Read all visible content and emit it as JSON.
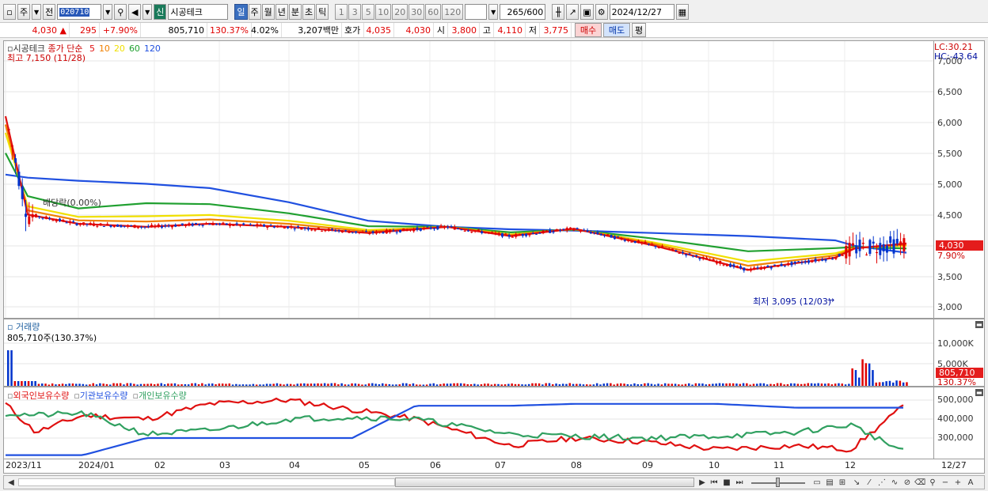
{
  "toolbar": {
    "market": "주",
    "mode": "전",
    "code": "020710",
    "new_tag": "신",
    "name": "시공테크",
    "periods": [
      "일",
      "주",
      "월",
      "년",
      "분",
      "초",
      "틱"
    ],
    "minutes": [
      "1",
      "3",
      "5",
      "10",
      "20",
      "30",
      "60",
      "120"
    ],
    "count": "265",
    "count_max": "/600",
    "date": "2024/12/27"
  },
  "quote": {
    "price": "4,030",
    "arrow": "▲",
    "change": "295",
    "change_pct": "+7.90%",
    "volume": "805,710",
    "vol_ratio": "130.37%",
    "turnover": "4.02%",
    "amount": "3,207백만",
    "hoga_label": "호가",
    "ask": "4,035",
    "bid": "4,030",
    "open_label": "시",
    "open": "3,800",
    "high_label": "고",
    "high": "4,110",
    "low_label": "저",
    "low": "3,775",
    "buy": "매수",
    "sell": "매도",
    "avg": "평"
  },
  "price_panel": {
    "title": "시공테크",
    "ma_label": "종가 단순",
    "ma_periods": [
      "5",
      "10",
      "20",
      "60",
      "120"
    ],
    "ma_colors": [
      "#e01010",
      "#f08000",
      "#f0e000",
      "#20a030",
      "#2050e0"
    ],
    "high_note": "최고 7,150 (11/28)",
    "low_note": "최저 3,095 (12/03)",
    "dividend": "배당락(0.00%)",
    "lc": "LC:30.21",
    "hc": "HC:-43.64",
    "cur_price": "4,030",
    "cur_pct": "7.90%",
    "y_ticks": [
      "7,000",
      "6,500",
      "6,000",
      "5,500",
      "5,000",
      "4,500",
      "4,000",
      "3,500",
      "3,000"
    ]
  },
  "volume_panel": {
    "title": "거래량",
    "info": "805,710주(130.37%)",
    "y_ticks": [
      "10,000K",
      "5,000K"
    ],
    "cur_vol": "805,710",
    "cur_pct": "130.37%"
  },
  "holding_panel": {
    "series": [
      "외국인보유수량",
      "기관보유수량",
      "개인보유수량"
    ],
    "series_colors": [
      "#e01010",
      "#2050e0",
      "#30a060"
    ],
    "y_ticks": [
      "500,000",
      "400,000",
      "300,000"
    ]
  },
  "x_axis": {
    "labels": [
      "2023/11",
      "2024/01",
      "02",
      "03",
      "04",
      "05",
      "06",
      "07",
      "08",
      "09",
      "10",
      "11",
      "12"
    ],
    "end": "12/27"
  },
  "chart_data": [
    {
      "type": "line",
      "title": "시공테크",
      "series": [
        {
          "name": "5",
          "values": [
            6100,
            4500,
            4350,
            4300,
            4350,
            4300,
            4200,
            4300,
            4150,
            4270,
            4000,
            3600,
            3800,
            3950,
            4030
          ]
        },
        {
          "name": "120",
          "values": [
            5150,
            5100,
            5050,
            5000,
            4930,
            4700,
            4400,
            4300,
            4260,
            4240,
            4200,
            4150,
            4080,
            3990,
            3880
          ]
        }
      ],
      "x": [
        "2023/11",
        "2023/12",
        "2024/01",
        "02",
        "03",
        "04",
        "05",
        "06",
        "07",
        "08",
        "09",
        "10",
        "11",
        "12/03",
        "12/27"
      ],
      "ylim": [
        3000,
        7000
      ]
    },
    {
      "type": "bar",
      "title": "거래량",
      "categories": [
        "2023/11",
        "2024/12"
      ],
      "values": [
        9000,
        805.7
      ],
      "ylim": [
        0,
        12000
      ]
    },
    {
      "type": "line",
      "series": [
        {
          "name": "외국인보유수량",
          "values": [
            480000,
            330000,
            420000,
            400000,
            480000,
            500000,
            450000,
            400000,
            260000,
            300000,
            280000,
            240000,
            260000,
            240000,
            480000
          ]
        },
        {
          "name": "기관보유수량",
          "values": [
            210000,
            210000,
            210000,
            300000,
            300000,
            300000,
            300000,
            470000,
            470000,
            480000,
            480000,
            480000,
            460000,
            460000,
            460000
          ]
        },
        {
          "name": "개인보유수량",
          "values": [
            430000,
            420000,
            430000,
            320000,
            340000,
            400000,
            410000,
            400000,
            320000,
            310000,
            300000,
            310000,
            330000,
            370000,
            220000
          ]
        }
      ],
      "ylim": [
        200000,
        550000
      ]
    }
  ]
}
